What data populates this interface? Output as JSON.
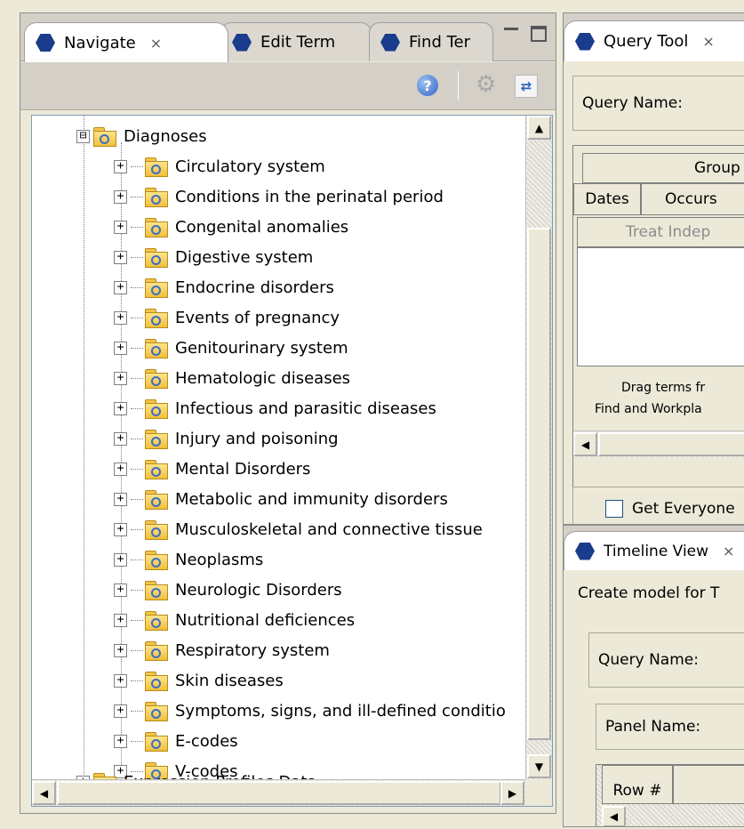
{
  "navigate_view": {
    "tabs": [
      {
        "label": "Navigate",
        "close": "⨯"
      },
      {
        "label": "Edit Term"
      },
      {
        "label": "Find Ter"
      }
    ],
    "icons": {
      "help": "help-icon",
      "options": "gear-icon",
      "sync": "sync-icon"
    },
    "tree": {
      "root": {
        "label": "Diagnoses",
        "expander": "⊟"
      },
      "children": [
        "Circulatory system",
        "Conditions in the perinatal period",
        "Congenital anomalies",
        "Digestive system",
        "Endocrine disorders",
        "Events of pregnancy",
        "Genitourinary system",
        "Hematologic diseases",
        "Infectious and parasitic diseases",
        "Injury and poisoning",
        "Mental Disorders",
        "Metabolic and immunity disorders",
        "Musculoskeletal and connective tissue",
        "Neoplasms",
        "Neurologic Disorders",
        "Nutritional deficiences",
        "Respiratory system",
        "Skin diseases",
        "Symptoms, signs, and ill-defined conditio",
        "E-codes",
        "V-codes"
      ],
      "next_sibling": "Expression Profiles Data"
    }
  },
  "query_tool": {
    "tab_label": "Query Tool",
    "query_name_label": "Query Name:",
    "group_header": "Group",
    "dates_header": "Dates",
    "occurs_header": "Occurs",
    "treat_button": "Treat Indep",
    "drag_hint_line1": "Drag terms fr",
    "drag_hint_line2": "Find and Workpla",
    "get_everyone_label": "Get Everyone"
  },
  "timeline_view": {
    "tab_label": "Timeline View",
    "create_label": "Create model for T",
    "query_name_label": "Query Name:",
    "panel_name_label": "Panel Name:",
    "row_header": "Row #"
  }
}
